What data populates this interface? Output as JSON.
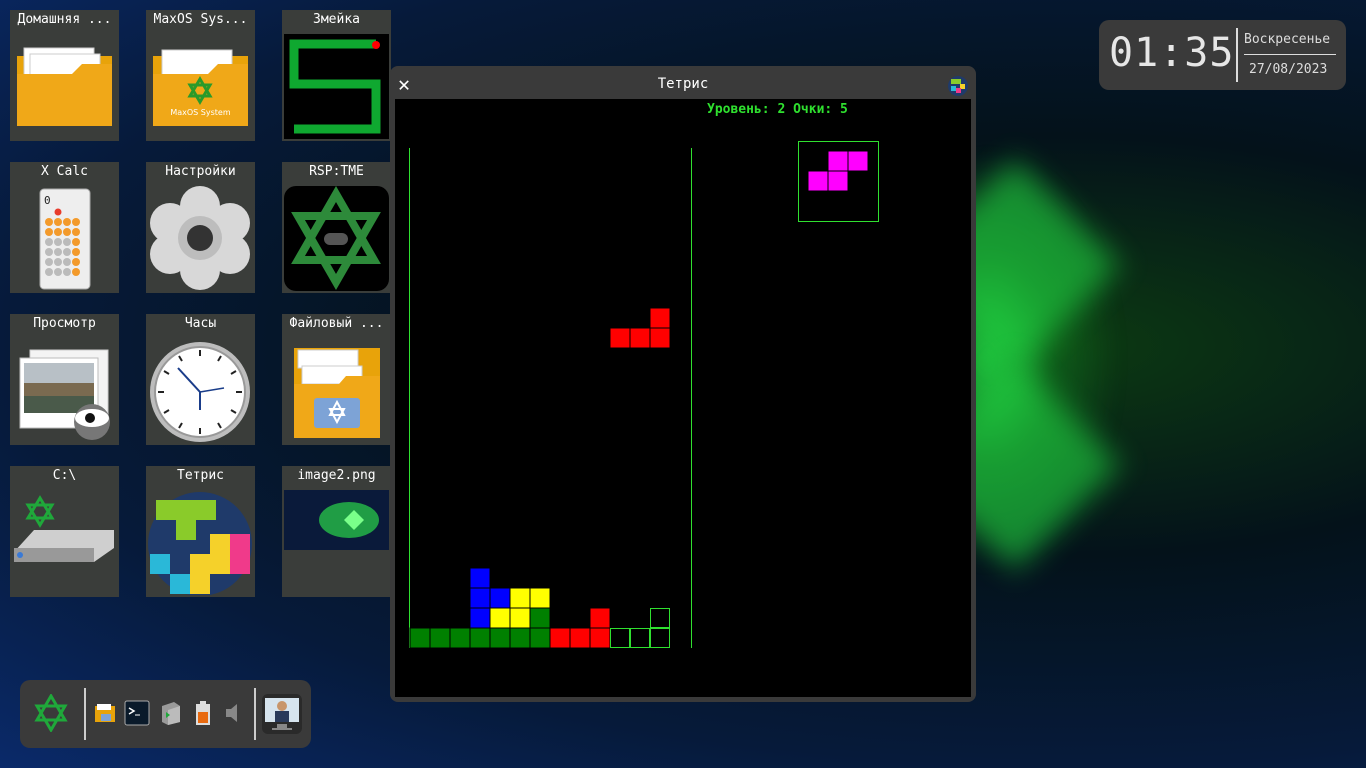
{
  "desktop": {
    "icons": [
      {
        "label": "Домашняя ..."
      },
      {
        "label": "MaxOS Sys..."
      },
      {
        "label": "Змейка"
      },
      {
        "label": "X Calc"
      },
      {
        "label": "Настройки"
      },
      {
        "label": "RSP:TME"
      },
      {
        "label": "Просмотр"
      },
      {
        "label": "Часы"
      },
      {
        "label": "Файловый ..."
      },
      {
        "label": "C:\\"
      },
      {
        "label": "Тетрис"
      },
      {
        "label": "image2.png"
      }
    ],
    "maxos_folder_caption": "MaxOS System",
    "calc_display": "0"
  },
  "clock": {
    "time": "01:35",
    "day": "Воскресенье",
    "date": "27/08/2023"
  },
  "tetris_window": {
    "title": "Тетрис",
    "close_glyph": "✕",
    "status": "Уровень: 2  Очки: 5",
    "level": 2,
    "score": 5
  },
  "colors": {
    "accent_green": "#2fe02f",
    "piece_red": "#ff0000",
    "piece_magenta": "#ff00ff",
    "piece_blue": "#0000ff",
    "piece_yellow": "#ffff00",
    "piece_green": "#008000"
  },
  "taskbar": {
    "items": [
      {
        "icon": "hexagram-menu-icon"
      },
      {
        "icon": "file-manager-icon"
      },
      {
        "icon": "terminal-icon"
      },
      {
        "icon": "package-icon"
      },
      {
        "icon": "battery-icon"
      },
      {
        "icon": "volume-icon"
      },
      {
        "icon": "user-avatar-icon"
      }
    ]
  }
}
